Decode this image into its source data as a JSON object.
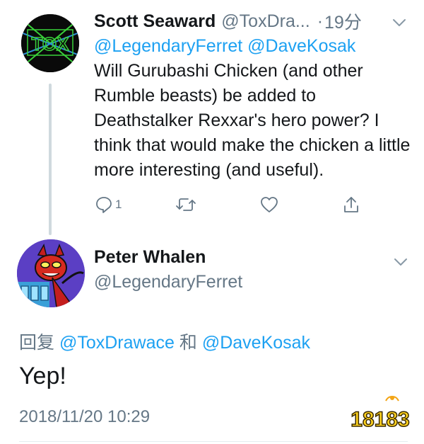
{
  "parent_tweet": {
    "avatar_text": "TOX",
    "display_name": "Scott Seaward",
    "handle": "@ToxDra...",
    "separator": "·",
    "time": "19分",
    "mentions": "@LegendaryFerret @DaveKosak",
    "text": "Will Gurubashi Chicken (and other Rumble beasts) be added to Deathstalker Rexxar's hero power? I think that would make the chicken a little more interesting (and useful).",
    "actions": {
      "reply_icon": "reply-icon",
      "reply_count": "1",
      "retweet_icon": "retweet-icon",
      "like_icon": "heart-icon",
      "share_icon": "share-icon"
    }
  },
  "main_tweet": {
    "display_name": "Peter Whalen",
    "handle": "@LegendaryFerret",
    "reply_prefix": "回复",
    "reply_mention_1": "@ToxDrawace",
    "reply_conjunction": "和",
    "reply_mention_2": "@DaveKosak",
    "text": "Yep!",
    "timestamp": "2018/11/20 10:29"
  },
  "watermark": {
    "text": "18183"
  },
  "colors": {
    "link": "#1da1f2",
    "secondary_text": "#657786",
    "primary_text": "#14171a",
    "thread_line": "#cfd9de"
  }
}
